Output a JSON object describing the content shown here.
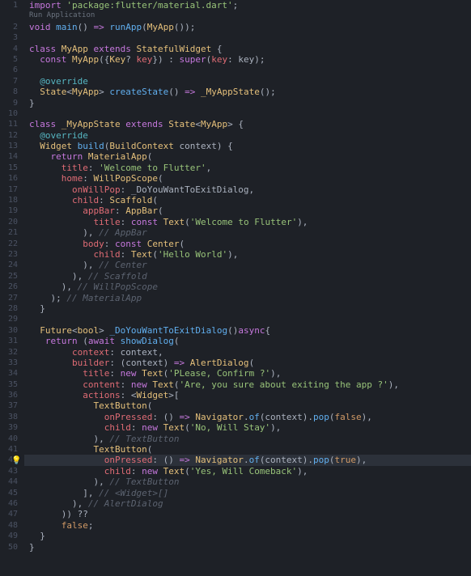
{
  "codelens": "Run Application",
  "lightbulb_line": 42,
  "highlighted_line": 42,
  "max_lines": 51,
  "lines": [
    [
      [
        "k",
        "import "
      ],
      [
        "s",
        "'package:flutter/material.dart'"
      ],
      [
        "p",
        ";"
      ]
    ],
    "CODELENS",
    [
      [
        "k",
        "void "
      ],
      [
        "f",
        "main"
      ],
      [
        "p",
        "() "
      ],
      [
        "k",
        "=>"
      ],
      [
        "p",
        " "
      ],
      [
        "f",
        "runApp"
      ],
      [
        "p",
        "("
      ],
      [
        "t",
        "MyApp"
      ],
      [
        "p",
        "());"
      ]
    ],
    [],
    [
      [
        "k",
        "class "
      ],
      [
        "t",
        "MyApp"
      ],
      [
        "k",
        " extends "
      ],
      [
        "t",
        "StatefulWidget"
      ],
      [
        "p",
        " {"
      ]
    ],
    [
      [
        "p",
        "  "
      ],
      [
        "k",
        "const "
      ],
      [
        "t",
        "MyApp"
      ],
      [
        "p",
        "({"
      ],
      [
        "t",
        "Key"
      ],
      [
        "p",
        "? "
      ],
      [
        "v",
        "key"
      ],
      [
        "p",
        "}) : "
      ],
      [
        "k",
        "super"
      ],
      [
        "p",
        "("
      ],
      [
        "v",
        "key"
      ],
      [
        "p",
        ": key);"
      ]
    ],
    [],
    [
      [
        "p",
        "  "
      ],
      [
        "a",
        "@override"
      ]
    ],
    [
      [
        "p",
        "  "
      ],
      [
        "t",
        "State"
      ],
      [
        "p",
        "<"
      ],
      [
        "t",
        "MyApp"
      ],
      [
        "p",
        "> "
      ],
      [
        "f",
        "createState"
      ],
      [
        "p",
        "() "
      ],
      [
        "k",
        "=>"
      ],
      [
        "p",
        " "
      ],
      [
        "t",
        "_MyAppState"
      ],
      [
        "p",
        "();"
      ]
    ],
    [
      [
        "p",
        "}"
      ]
    ],
    [],
    [
      [
        "k",
        "class "
      ],
      [
        "t",
        "_MyAppState"
      ],
      [
        "k",
        " extends "
      ],
      [
        "t",
        "State"
      ],
      [
        "p",
        "<"
      ],
      [
        "t",
        "MyApp"
      ],
      [
        "p",
        "> {"
      ]
    ],
    [
      [
        "p",
        "  "
      ],
      [
        "a",
        "@override"
      ]
    ],
    [
      [
        "p",
        "  "
      ],
      [
        "t",
        "Widget "
      ],
      [
        "f",
        "build"
      ],
      [
        "p",
        "("
      ],
      [
        "t",
        "BuildContext"
      ],
      [
        "p",
        " context) {"
      ]
    ],
    [
      [
        "p",
        "    "
      ],
      [
        "k",
        "return "
      ],
      [
        "t",
        "MaterialApp"
      ],
      [
        "p",
        "("
      ]
    ],
    [
      [
        "p",
        "      "
      ],
      [
        "v",
        "title"
      ],
      [
        "p",
        ": "
      ],
      [
        "s",
        "'Welcome to Flutter'"
      ],
      [
        "p",
        ","
      ]
    ],
    [
      [
        "p",
        "      "
      ],
      [
        "v",
        "home"
      ],
      [
        "p",
        ": "
      ],
      [
        "t",
        "WillPopScope"
      ],
      [
        "p",
        "("
      ]
    ],
    [
      [
        "p",
        "        "
      ],
      [
        "v",
        "onWillPop"
      ],
      [
        "p",
        ": _DoYouWantToExitDialog,"
      ]
    ],
    [
      [
        "p",
        "        "
      ],
      [
        "v",
        "child"
      ],
      [
        "p",
        ": "
      ],
      [
        "t",
        "Scaffold"
      ],
      [
        "p",
        "("
      ]
    ],
    [
      [
        "p",
        "          "
      ],
      [
        "v",
        "appBar"
      ],
      [
        "p",
        ": "
      ],
      [
        "t",
        "AppBar"
      ],
      [
        "p",
        "("
      ]
    ],
    [
      [
        "p",
        "            "
      ],
      [
        "v",
        "title"
      ],
      [
        "p",
        ": "
      ],
      [
        "k",
        "const "
      ],
      [
        "t",
        "Text"
      ],
      [
        "p",
        "("
      ],
      [
        "s",
        "'Welcome to Flutter'"
      ],
      [
        "p",
        "),"
      ]
    ],
    [
      [
        "p",
        "          ), "
      ],
      [
        "c",
        "// AppBar"
      ]
    ],
    [
      [
        "p",
        "          "
      ],
      [
        "v",
        "body"
      ],
      [
        "p",
        ": "
      ],
      [
        "k",
        "const "
      ],
      [
        "t",
        "Center"
      ],
      [
        "p",
        "("
      ]
    ],
    [
      [
        "p",
        "            "
      ],
      [
        "v",
        "child"
      ],
      [
        "p",
        ": "
      ],
      [
        "t",
        "Text"
      ],
      [
        "p",
        "("
      ],
      [
        "s",
        "'Hello World'"
      ],
      [
        "p",
        "),"
      ]
    ],
    [
      [
        "p",
        "          ), "
      ],
      [
        "c",
        "// Center"
      ]
    ],
    [
      [
        "p",
        "        ), "
      ],
      [
        "c",
        "// Scaffold"
      ]
    ],
    [
      [
        "p",
        "      ), "
      ],
      [
        "c",
        "// WillPopScope"
      ]
    ],
    [
      [
        "p",
        "    ); "
      ],
      [
        "c",
        "// MaterialApp"
      ]
    ],
    [
      [
        "p",
        "  }"
      ]
    ],
    [],
    [
      [
        "p",
        "  "
      ],
      [
        "t",
        "Future"
      ],
      [
        "p",
        "<"
      ],
      [
        "t",
        "bool"
      ],
      [
        "p",
        "> "
      ],
      [
        "f",
        "_DoYouWantToExitDialog"
      ],
      [
        "p",
        "()"
      ],
      [
        "k",
        "async"
      ],
      [
        "p",
        "{"
      ]
    ],
    [
      [
        "p",
        "   "
      ],
      [
        "k",
        "return"
      ],
      [
        "p",
        " ("
      ],
      [
        "k",
        "await"
      ],
      [
        "p",
        " "
      ],
      [
        "f",
        "showDialog"
      ],
      [
        "p",
        "("
      ]
    ],
    [
      [
        "p",
        "        "
      ],
      [
        "v",
        "context"
      ],
      [
        "p",
        ": context,"
      ]
    ],
    [
      [
        "p",
        "        "
      ],
      [
        "v",
        "builder"
      ],
      [
        "p",
        ": (context) "
      ],
      [
        "k",
        "=>"
      ],
      [
        "p",
        " "
      ],
      [
        "t",
        "AlertDialog"
      ],
      [
        "p",
        "("
      ]
    ],
    [
      [
        "p",
        "          "
      ],
      [
        "v",
        "title"
      ],
      [
        "p",
        ": "
      ],
      [
        "k",
        "new "
      ],
      [
        "t",
        "Text"
      ],
      [
        "p",
        "("
      ],
      [
        "s",
        "'PLease, Confirm ?'"
      ],
      [
        "p",
        "),"
      ]
    ],
    [
      [
        "p",
        "          "
      ],
      [
        "v",
        "content"
      ],
      [
        "p",
        ": "
      ],
      [
        "k",
        "new "
      ],
      [
        "t",
        "Text"
      ],
      [
        "p",
        "("
      ],
      [
        "s",
        "'Are, you sure about exiting the app ?'"
      ],
      [
        "p",
        "),"
      ]
    ],
    [
      [
        "p",
        "          "
      ],
      [
        "v",
        "actions"
      ],
      [
        "p",
        ": <"
      ],
      [
        "t",
        "Widget"
      ],
      [
        "p",
        ">["
      ]
    ],
    [
      [
        "p",
        "            "
      ],
      [
        "t",
        "TextButton"
      ],
      [
        "p",
        "("
      ]
    ],
    [
      [
        "p",
        "              "
      ],
      [
        "v",
        "onPressed"
      ],
      [
        "p",
        ": () "
      ],
      [
        "k",
        "=>"
      ],
      [
        "p",
        " "
      ],
      [
        "t",
        "Navigator"
      ],
      [
        "p",
        "."
      ],
      [
        "f",
        "of"
      ],
      [
        "p",
        "(context)."
      ],
      [
        "f",
        "pop"
      ],
      [
        "p",
        "("
      ],
      [
        "n",
        "false"
      ],
      [
        "p",
        "),"
      ]
    ],
    [
      [
        "p",
        "              "
      ],
      [
        "v",
        "child"
      ],
      [
        "p",
        ": "
      ],
      [
        "k",
        "new "
      ],
      [
        "t",
        "Text"
      ],
      [
        "p",
        "("
      ],
      [
        "s",
        "'No, Will Stay'"
      ],
      [
        "p",
        "),"
      ]
    ],
    [
      [
        "p",
        "            ), "
      ],
      [
        "c",
        "// TextButton"
      ]
    ],
    [
      [
        "p",
        "            "
      ],
      [
        "t",
        "TextButton"
      ],
      [
        "p",
        "("
      ]
    ],
    [
      [
        "p",
        "              "
      ],
      [
        "v",
        "onPressed"
      ],
      [
        "p",
        ": () "
      ],
      [
        "k",
        "=>"
      ],
      [
        "p",
        " "
      ],
      [
        "t",
        "Navigator"
      ],
      [
        "p",
        "."
      ],
      [
        "f",
        "of"
      ],
      [
        "p",
        "(context)."
      ],
      [
        "f",
        "pop"
      ],
      [
        "p",
        "("
      ],
      [
        "n",
        "true"
      ],
      [
        "p",
        "),"
      ]
    ],
    [
      [
        "p",
        "              "
      ],
      [
        "v",
        "child"
      ],
      [
        "p",
        ": "
      ],
      [
        "k",
        "new "
      ],
      [
        "t",
        "Text"
      ],
      [
        "p",
        "("
      ],
      [
        "s",
        "'Yes, Will Comeback'"
      ],
      [
        "p",
        "),"
      ]
    ],
    [
      [
        "p",
        "            ), "
      ],
      [
        "c",
        "// TextButton"
      ]
    ],
    [
      [
        "p",
        "          ], "
      ],
      [
        "c",
        "// <Widget>[]"
      ]
    ],
    [
      [
        "p",
        "        ), "
      ],
      [
        "c",
        "// AlertDialog"
      ]
    ],
    [
      [
        "p",
        "      )) ??"
      ]
    ],
    [
      [
        "p",
        "      "
      ],
      [
        "n",
        "false"
      ],
      [
        "p",
        ";"
      ]
    ],
    [
      [
        "p",
        "  }"
      ]
    ],
    [
      [
        "p",
        "}"
      ]
    ]
  ]
}
